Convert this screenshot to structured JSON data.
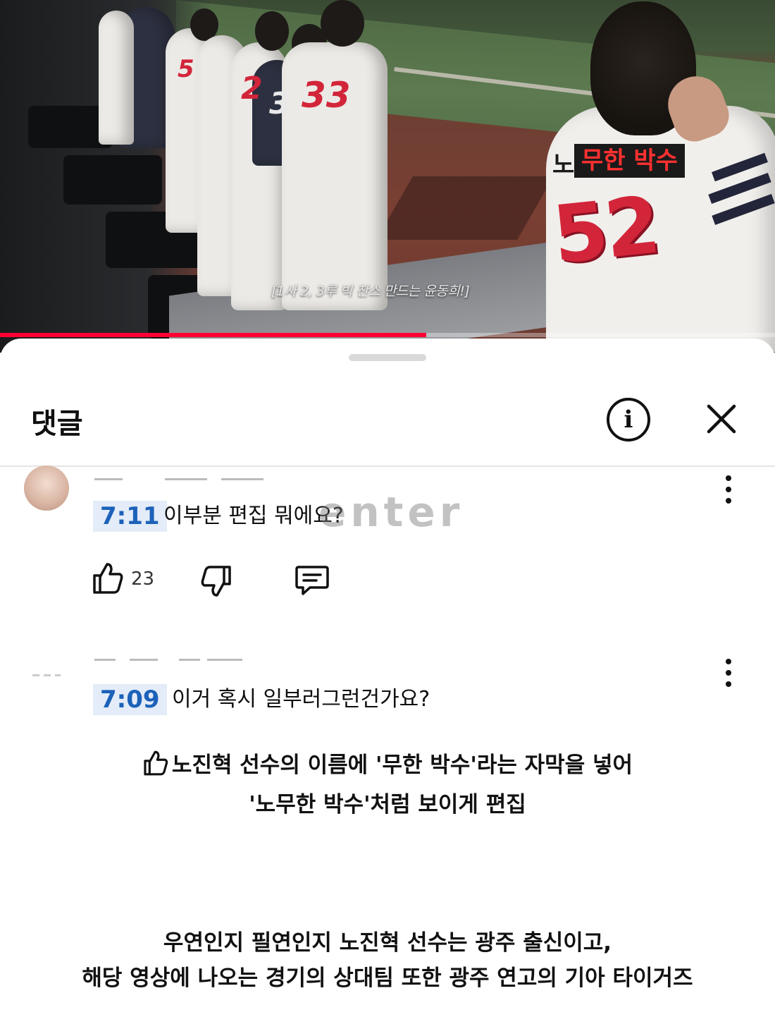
{
  "video": {
    "overlay_caption": "무한 박수",
    "name_fragment": "노",
    "jersey_number": "52",
    "subtitle": "[1사 2, 3루 빅 찬스 만드는 윤동희!]",
    "progress_fraction": 0.55,
    "background_jersey_numbers": [
      "5",
      "2",
      "3",
      "33"
    ]
  },
  "sheet": {
    "title": "댓글",
    "info_icon": "info-icon",
    "close_icon": "close-icon"
  },
  "comments": [
    {
      "timestamp": "7:11",
      "text": "이부분 편집 뭐에요?",
      "like_count": "23"
    },
    {
      "timestamp": "7:09",
      "text": "이거 혹시 일부러그런건가요?"
    }
  ],
  "watermark": "enter",
  "annotations": {
    "first": {
      "line1": "노진혁 선수의 이름에 '무한 박수'라는 자막을 넣어",
      "line2": "'노무한 박수'처럼 보이게 편집"
    },
    "second": {
      "line1": "우연인지 필연인지 노진혁 선수는 광주 출신이고,",
      "line2": "해당 영상에 나오는 경기의 상대팀 또한 광주 연고의 기아 타이거즈"
    }
  },
  "colors": {
    "timestamp_bg": "#e3ecf8",
    "timestamp_text": "#1c62b9",
    "caption_red": "#ff3030",
    "progress": "#ff0033"
  }
}
